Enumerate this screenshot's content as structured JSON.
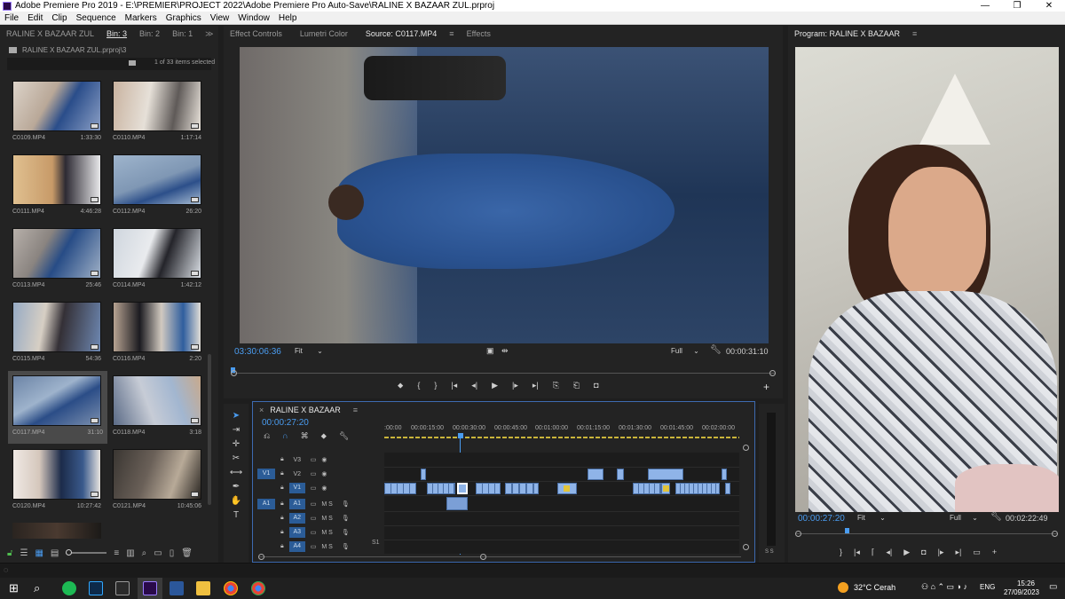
{
  "window": {
    "title": "Adobe Premiere Pro 2019 - E:\\PREMIER\\PROJECT 2022\\Adobe Premiere Pro Auto-Save\\RALINE X BAZAAR ZUL.prproj",
    "controls": [
      "—",
      "❐",
      "✕"
    ]
  },
  "menu": [
    "File",
    "Edit",
    "Clip",
    "Sequence",
    "Markers",
    "Graphics",
    "View",
    "Window",
    "Help"
  ],
  "project": {
    "tabs": [
      "RALINE X BAZAAR ZUL",
      "Bin: 3",
      "Bin: 2",
      "Bin: 1"
    ],
    "path": "RALINE X BAZAAR ZUL.prproj\\3",
    "selection": "1 of 33 items selected",
    "clips": [
      {
        "name": "C0109.MP4",
        "duration": "1:33:30"
      },
      {
        "name": "C0110.MP4",
        "duration": "1:17:14"
      },
      {
        "name": "C0111.MP4",
        "duration": "4:46:28"
      },
      {
        "name": "C0112.MP4",
        "duration": "26:20"
      },
      {
        "name": "C0113.MP4",
        "duration": "25:46"
      },
      {
        "name": "C0114.MP4",
        "duration": "1:42:12"
      },
      {
        "name": "C0115.MP4",
        "duration": "54:36"
      },
      {
        "name": "C0116.MP4",
        "duration": "2:20"
      },
      {
        "name": "C0117.MP4",
        "duration": "31:10"
      },
      {
        "name": "C0118.MP4",
        "duration": "3:18"
      },
      {
        "name": "C0120.MP4",
        "duration": "10:27:42"
      },
      {
        "name": "C0121.MP4",
        "duration": "10:45:06"
      }
    ]
  },
  "source": {
    "tabs": [
      "Effect Controls",
      "Lumetri Color",
      "Source: C0117.MP4",
      "Effects"
    ],
    "timecode": "03:30:06:36",
    "zoom": "Fit",
    "resolution": "Full",
    "duration": "00:00:31:10"
  },
  "program": {
    "title": "Program: RALINE X BAZAAR",
    "timecode": "00:00:27:20",
    "zoom": "Fit",
    "resolution": "Full",
    "duration": "00:02:22:49"
  },
  "timeline": {
    "sequence": "RALINE X BAZAAR",
    "timecode": "00:00:27:20",
    "ruler": [
      ":00:00",
      "00:00:15:00",
      "00:00:30:00",
      "00:00:45:00",
      "00:01:00:00",
      "00:01:15:00",
      "00:01:30:00",
      "00:01:45:00",
      "00:02:00:00"
    ],
    "tracks": [
      {
        "id": "V3",
        "src": "",
        "extra": ""
      },
      {
        "id": "V2",
        "src": "",
        "extra": ""
      },
      {
        "id": "V1",
        "src": "V1",
        "extra": ""
      },
      {
        "id": "A1",
        "src": "A1",
        "extra": "M S"
      },
      {
        "id": "A2",
        "src": "",
        "extra": "M S"
      },
      {
        "id": "A3",
        "src": "",
        "extra": "M S"
      },
      {
        "id": "A4",
        "src": "",
        "extra": "M S"
      }
    ],
    "meter_label": "S S"
  },
  "taskbar": {
    "weather": "32°C  Cerah",
    "lang": "ENG",
    "time": "15:26",
    "date": "27/09/2023"
  }
}
